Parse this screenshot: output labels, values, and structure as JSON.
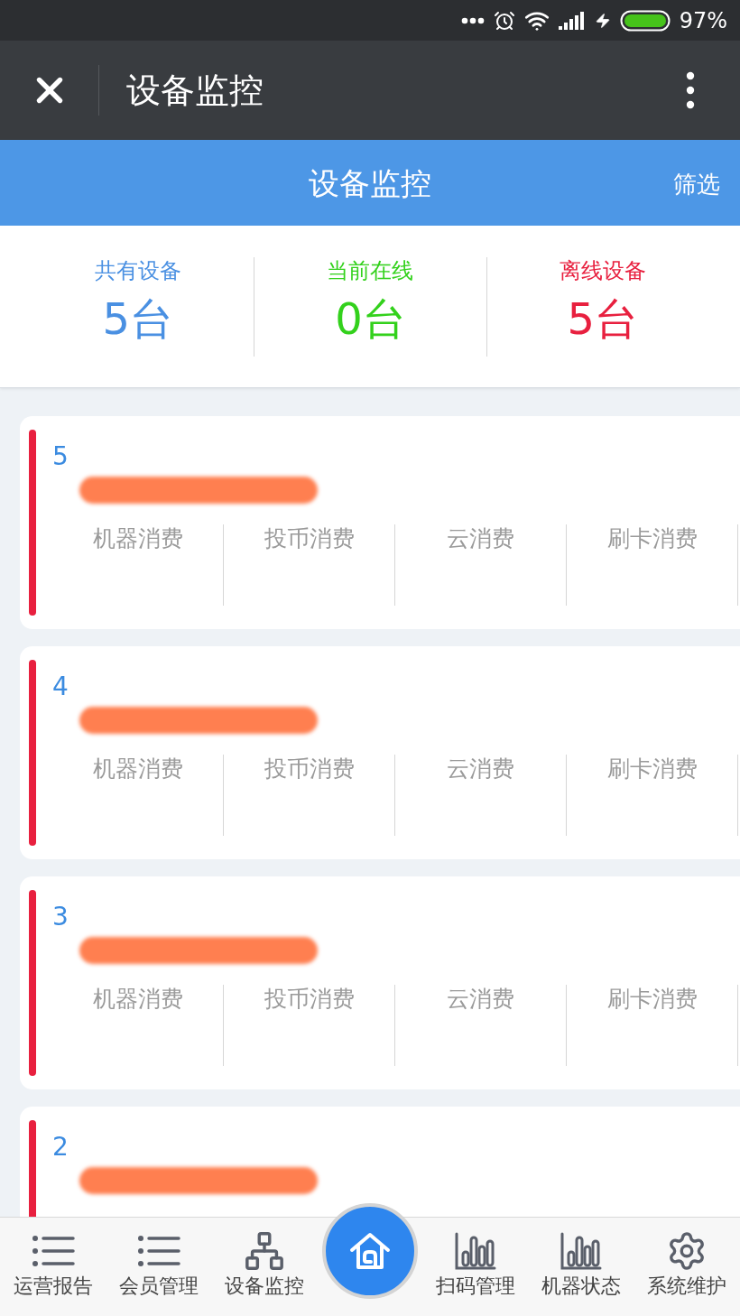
{
  "status_bar": {
    "battery": "97%"
  },
  "app_bar": {
    "title": "设备监控"
  },
  "header": {
    "title": "设备监控",
    "filter": "筛选"
  },
  "stats": [
    {
      "label": "共有设备",
      "value": "5台",
      "color": "#4a90e2"
    },
    {
      "label": "当前在线",
      "value": "0台",
      "color": "#33d11c"
    },
    {
      "label": "离线设备",
      "value": "5台",
      "color": "#e8203f"
    }
  ],
  "devices": [
    {
      "number": "5",
      "online": false,
      "columns": [
        "机器消费",
        "投币消费",
        "云消费",
        "刷卡消费"
      ]
    },
    {
      "number": "4",
      "online": false,
      "columns": [
        "机器消费",
        "投币消费",
        "云消费",
        "刷卡消费"
      ]
    },
    {
      "number": "3",
      "online": false,
      "columns": [
        "机器消费",
        "投币消费",
        "云消费",
        "刷卡消费"
      ]
    },
    {
      "number": "2",
      "online": false
    }
  ],
  "bottom_nav": [
    {
      "kind": "tab",
      "label": "运营报告"
    },
    {
      "kind": "tab",
      "label": "会员管理"
    },
    {
      "kind": "tab",
      "label": "设备监控"
    },
    {
      "kind": "home"
    },
    {
      "kind": "tab",
      "label": "扫码管理"
    },
    {
      "kind": "tab",
      "label": "机器状态"
    },
    {
      "kind": "tab",
      "label": "系统维护"
    }
  ]
}
